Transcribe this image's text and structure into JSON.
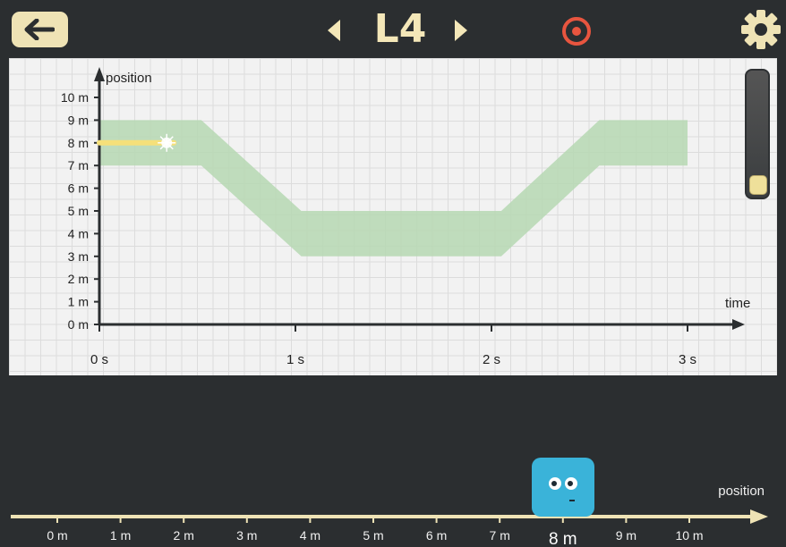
{
  "header": {
    "level_label": "L4",
    "back_icon": "arrow-left-icon",
    "prev_icon": "triangle-left-icon",
    "next_icon": "triangle-right-icon",
    "target_icon": "target-icon",
    "settings_icon": "gear-icon"
  },
  "colors": {
    "bar": "#2b2e30",
    "button_bg": "#efe3b5",
    "accent_red": "#e8553f",
    "zone": "#b6d8b3",
    "trace": "#f5e07a",
    "character": "#3ab3d9"
  },
  "chart_data": {
    "type": "line",
    "ylabel": "position",
    "xlabel": "time",
    "y_ticks": [
      "0 m",
      "1 m",
      "2 m",
      "3 m",
      "4 m",
      "5 m",
      "6 m",
      "7 m",
      "8 m",
      "9 m",
      "10 m"
    ],
    "x_ticks": [
      "0 s",
      "1 s",
      "2 s",
      "3 s"
    ],
    "xlim": [
      0,
      3.25
    ],
    "ylim": [
      0,
      10.5
    ],
    "target_band": {
      "x": [
        0,
        0.52,
        1.03,
        2.05,
        2.55,
        3.0
      ],
      "upper": [
        9,
        9,
        5,
        5,
        9,
        9
      ],
      "lower": [
        7,
        7,
        3,
        3,
        7,
        7
      ]
    },
    "series": [
      {
        "x": [
          0,
          0.38
        ],
        "y": [
          8,
          8
        ]
      }
    ],
    "grid": true
  },
  "slider": {
    "level": 0.15
  },
  "number_line": {
    "label": "position",
    "ticks": [
      "0 m",
      "1 m",
      "2 m",
      "3 m",
      "4 m",
      "5 m",
      "6 m",
      "7 m",
      "8 m",
      "9 m",
      "10 m"
    ],
    "current_label": "8 m",
    "current_value": 8
  }
}
